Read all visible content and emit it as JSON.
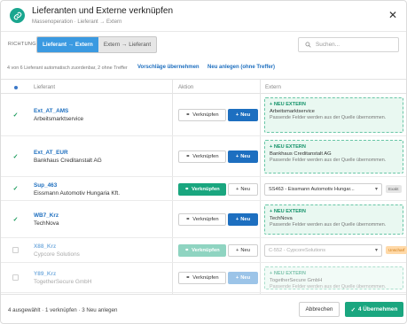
{
  "dialog": {
    "title": "Lieferanten und Externe verknüpfen",
    "subtitle": "Massenoperation · Lieferant → Extern",
    "close_icon": "close-icon"
  },
  "direction": {
    "label": "RICHTUNG",
    "options": [
      "Lieferant → Extern",
      "Extern → Lieferant"
    ],
    "selected": "Lieferant → Extern"
  },
  "search": {
    "placeholder": "Suchen..."
  },
  "info": {
    "text": "4 von 6 Lieferant automatisch zuordenbar, 2 ohne Treffer",
    "link_suggestions": "Vorschläge übernehmen",
    "link_new": "Neu anlegen (ohne Treffer)"
  },
  "table": {
    "columns": [
      "Lieferant",
      "Aktion",
      "Extern"
    ],
    "rows": [
      {
        "checked": true,
        "dimmed": false,
        "code": "Ext_AT_AMS",
        "name": "Arbeitsmarktservice",
        "link_label": "Verknüpfen",
        "link_active": false,
        "new_label": "Neu",
        "new_active": true,
        "ext_type": "new",
        "ext_title": "NEU EXTERN",
        "ext_name": "Arbeitsmarktservice",
        "ext_hint": "Passende Felder werden aus der Quelle übernommen."
      },
      {
        "checked": true,
        "dimmed": false,
        "code": "Ext_AT_EUR",
        "name": "Bankhaus Creditanstalt AG",
        "link_label": "Verknüpfen",
        "link_active": false,
        "new_label": "Neu",
        "new_active": true,
        "ext_type": "new",
        "ext_title": "NEU EXTERN",
        "ext_name": "Bankhaus Creditanstalt AG",
        "ext_hint": "Passende Felder werden aus der Quelle übernommen."
      },
      {
        "checked": true,
        "dimmed": false,
        "code": "Sup_463",
        "name": "Eissmann Automotiv Hungaria Kft.",
        "link_label": "Verknüpfen",
        "link_active": true,
        "new_label": "Neu",
        "new_active": false,
        "ext_type": "select",
        "ext_value": "SS463 - Eissmann Automotiv Hungar...",
        "tag": "Exakt",
        "tag_color": "grey"
      },
      {
        "checked": true,
        "dimmed": false,
        "code": "WB7_Krz",
        "name": "TechNova",
        "link_label": "Verknüpfen",
        "link_active": false,
        "new_label": "Neu",
        "new_active": true,
        "ext_type": "new",
        "ext_title": "NEU EXTERN",
        "ext_name": "TechNova",
        "ext_hint": "Passende Felder werden aus der Quelle übernommen."
      },
      {
        "checked": false,
        "dimmed": true,
        "code": "X88_Krz",
        "name": "Cypcore Solutions",
        "link_label": "Verknüpfen",
        "link_active": true,
        "new_label": "Neu",
        "new_active": false,
        "ext_type": "select",
        "ext_value": "C-552 - CypcoreSolutions",
        "tag": "Unscharf",
        "tag_color": "orange"
      },
      {
        "checked": false,
        "dimmed": true,
        "code": "Y89_Krz",
        "name": "TogetherSecure GmbH",
        "link_label": "Verknüpfen",
        "link_active": false,
        "new_label": "Neu",
        "new_active": true,
        "ext_type": "new",
        "ext_title": "NEU EXTERN",
        "ext_name": "TogetherSecure GmbH",
        "ext_hint": "Passende Felder werden aus der Quelle übernommen."
      }
    ]
  },
  "footer": {
    "summary": "4 ausgewählt · 1 verknüpfen · 3 Neu anlegen",
    "cancel": "Abbrechen",
    "apply": "4 Übernehmen"
  },
  "colors": {
    "primary": "#1d6fc0",
    "accent": "#1aa67f",
    "link": "#1e6fbf"
  }
}
